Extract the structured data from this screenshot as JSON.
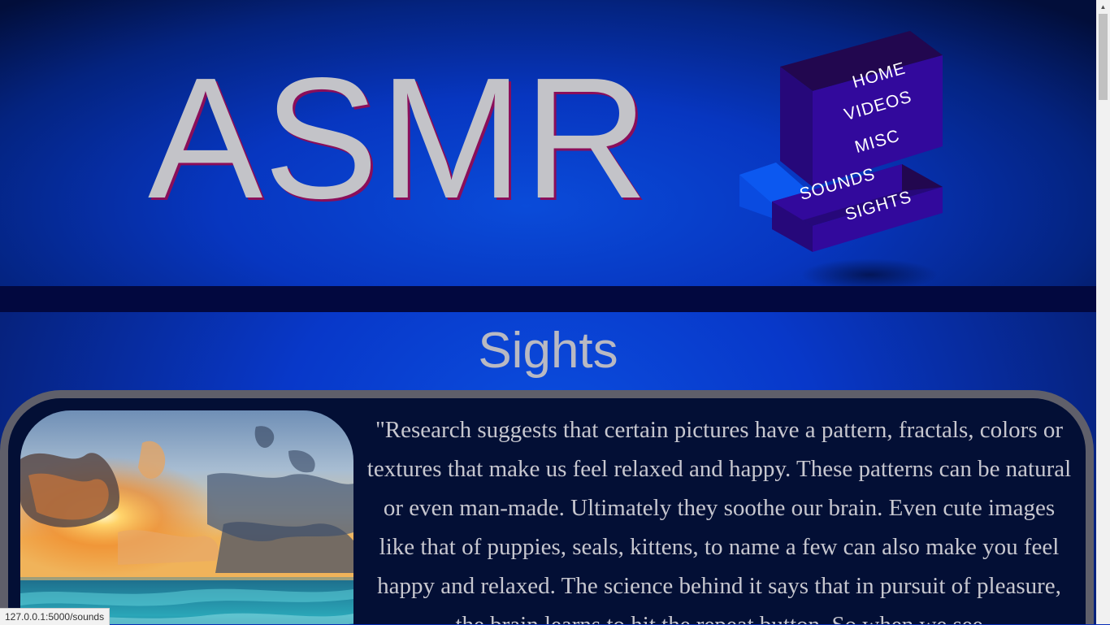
{
  "header": {
    "logo_text": "ASMR"
  },
  "nav": {
    "items": [
      {
        "label": "HOME"
      },
      {
        "label": "VIDEOS"
      },
      {
        "label": "MISC"
      },
      {
        "label": "SOUNDS"
      },
      {
        "label": "SIGHTS"
      }
    ]
  },
  "section": {
    "title": "Sights"
  },
  "article": {
    "quote": "\"Research suggests that certain pictures have a pattern, fractals, colors or textures that make us feel relaxed and happy. These patterns can be natural or even man-made. Ultimately they soothe our brain. Even cute images like that of puppies, seals, kittens, to name a few can also make you feel happy and relaxed. The science behind it says that in pursuit of pleasure, the brain learns to hit the repeat button. So when we see"
  },
  "status_bar": {
    "url": "127.0.0.1:5000/sounds"
  },
  "colors": {
    "header_blue": "#0736c0",
    "nav_purple": "#300a96",
    "nav_light_blue": "#0a4be0",
    "card_dark": "#030f35",
    "card_border": "#5f5f6a",
    "logo_gray": "#c3c3c8",
    "logo_shadow": "#8a0e5a"
  }
}
